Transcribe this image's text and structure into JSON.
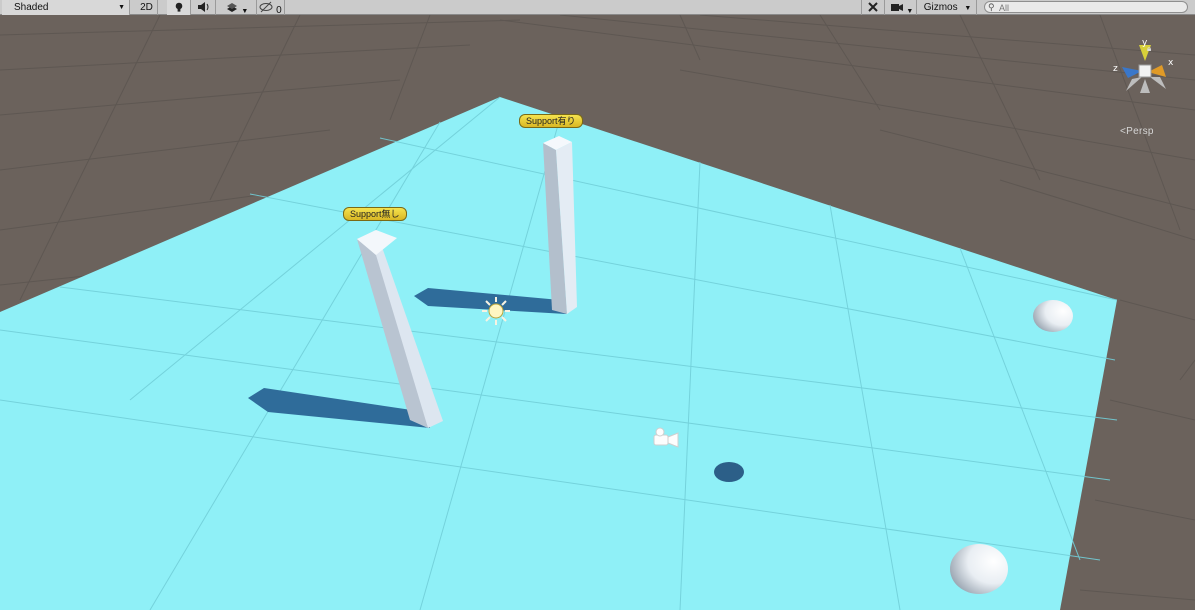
{
  "toolbar": {
    "shading_mode": "Shaded",
    "toggle_2d": "2D",
    "hidden_count": "0",
    "gizmos_label": "Gizmos",
    "search_placeholder": "All"
  },
  "scene": {
    "labels": {
      "support_with": "Support有り",
      "support_without": "Support無し"
    },
    "view_mode": "Persp",
    "axis_labels": {
      "x": "x",
      "y": "y",
      "z": "z"
    }
  },
  "colors": {
    "background": "#6b625c",
    "plane": "#8ff0f7",
    "grid_dark": "#5b5450",
    "shadow": "#2f6c9a",
    "label_fill": "#f0d43a"
  },
  "icons": [
    "lightbulb-icon",
    "speaker-icon",
    "effects-icon",
    "visibility-icon",
    "tools-icon",
    "camera-icon",
    "search-icon",
    "sun-icon",
    "camera-object-icon",
    "lock-icon"
  ]
}
